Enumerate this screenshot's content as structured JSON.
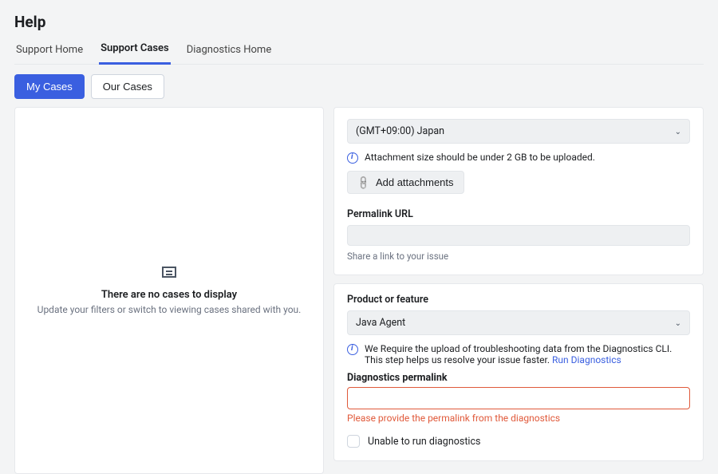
{
  "pageTitle": "Help",
  "tabs": [
    {
      "label": "Support Home"
    },
    {
      "label": "Support Cases"
    },
    {
      "label": "Diagnostics Home"
    }
  ],
  "caseToggle": {
    "myCases": "My Cases",
    "ourCases": "Our Cases"
  },
  "emptyState": {
    "heading": "There are no cases to display",
    "subtext": "Update your filters or switch to viewing cases shared with you."
  },
  "form": {
    "timezone": {
      "value": "(GMT+09:00) Japan"
    },
    "attachmentInfo": "Attachment size should be under 2 GB to be uploaded.",
    "addAttachments": "Add attachments",
    "permalink": {
      "label": "Permalink URL",
      "hint": "Share a link to your issue"
    },
    "product": {
      "label": "Product or feature",
      "value": "Java Agent"
    },
    "diagInfo": {
      "text": "We Require the upload of troubleshooting data from the Diagnostics CLI. This step helps us resolve your issue faster. ",
      "link": "Run Diagnostics"
    },
    "diagPermalink": {
      "label": "Diagnostics permalink",
      "error": "Please provide the permalink from the diagnostics"
    },
    "unable": "Unable to run diagnostics"
  }
}
